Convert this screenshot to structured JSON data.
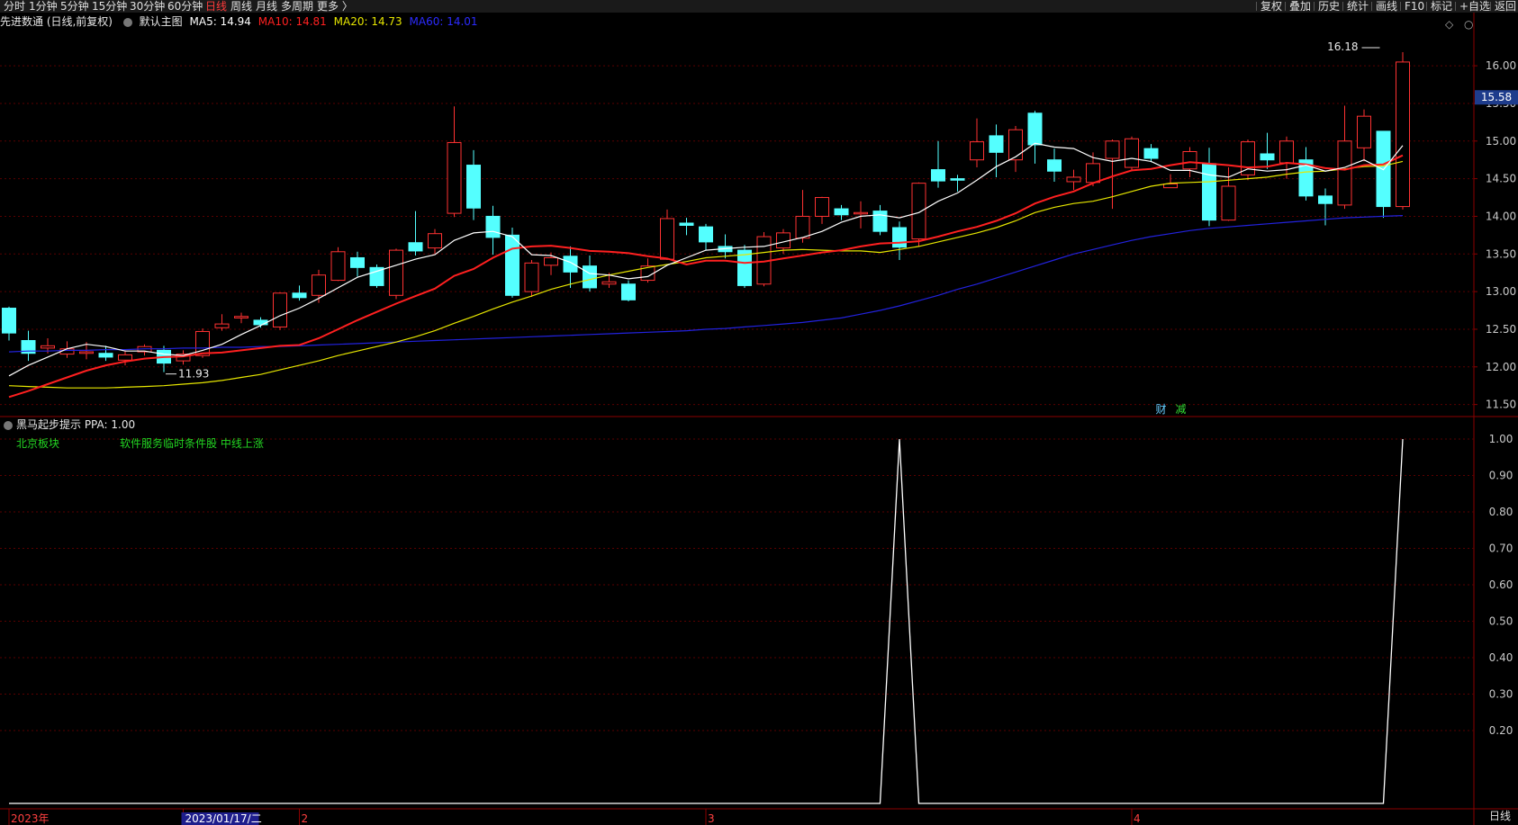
{
  "toolbar": {
    "left": [
      {
        "label": "分时"
      },
      {
        "label": "1分钟"
      },
      {
        "label": "5分钟"
      },
      {
        "label": "15分钟"
      },
      {
        "label": "30分钟"
      },
      {
        "label": "60分钟"
      },
      {
        "label": "日线",
        "active": true
      },
      {
        "label": "周线"
      },
      {
        "label": "月线"
      },
      {
        "label": "多周期"
      },
      {
        "label": "更多 〉"
      }
    ],
    "right": [
      {
        "label": "复权"
      },
      {
        "label": "叠加"
      },
      {
        "label": "历史"
      },
      {
        "label": "统计"
      },
      {
        "label": "画线"
      },
      {
        "label": "F10"
      },
      {
        "label": "标记"
      },
      {
        "label": "+自选"
      },
      {
        "label": "返回"
      }
    ]
  },
  "legend": {
    "stock": "先进数通 (日线,前复权)",
    "main_label": "默认主图",
    "ma5": "MA5: 14.94",
    "ma10": "MA10: 14.81",
    "ma20": "MA20: 14.73",
    "ma60": "MA60: 14.01"
  },
  "indicator": {
    "title": "黑马起步提示 PPA: 1.00",
    "label1": "北京板块",
    "label2": "软件服务临时条件股  中线上涨"
  },
  "badges": {
    "cai": "财",
    "jian": "减"
  },
  "price_tag": "15.58",
  "bottom_right": "日线",
  "colors": {
    "up": "#ff3232",
    "down": "#54ffff",
    "ma5": "#ffffff",
    "ma10": "#ff2020",
    "ma20": "#e6e600",
    "ma60": "#2222dd",
    "grid": "#5a0000",
    "axis": "#8b0000",
    "ppa": "#ffffff"
  },
  "chart_data": [
    {
      "type": "candlestick",
      "title": "先进数通 (日线,前复权)",
      "ylim": [
        11.4,
        16.3
      ],
      "yticks": [
        11.5,
        12.0,
        12.5,
        13.0,
        13.5,
        14.0,
        14.5,
        15.0,
        15.5,
        16.0
      ],
      "ytick_labels": [
        "11.50",
        "12.00",
        "12.50",
        "13.00",
        "13.50",
        "14.00",
        "14.50",
        "15.00",
        "15.50",
        "16.00"
      ],
      "xtick_labels": [
        "2023年",
        "2023/01/17/二",
        "2",
        "3",
        "4"
      ],
      "xtick_index": [
        0,
        9,
        15,
        36,
        58
      ],
      "annotations": [
        {
          "text": "16.18",
          "index": 71,
          "value": 16.18
        },
        {
          "text": "11.93",
          "index": 8,
          "value": 11.93
        }
      ],
      "candles": [
        [
          12.78,
          12.45,
          12.8,
          12.35
        ],
        [
          12.35,
          12.18,
          12.48,
          12.08
        ],
        [
          12.25,
          12.28,
          12.38,
          12.18
        ],
        [
          12.17,
          12.24,
          12.34,
          12.12
        ],
        [
          12.18,
          12.2,
          12.33,
          12.1
        ],
        [
          12.18,
          12.13,
          12.28,
          12.08
        ],
        [
          12.09,
          12.16,
          12.22,
          12.02
        ],
        [
          12.2,
          12.27,
          12.3,
          12.15
        ],
        [
          12.22,
          12.05,
          12.28,
          11.93
        ],
        [
          12.08,
          12.17,
          12.22,
          12.03
        ],
        [
          12.15,
          12.47,
          12.51,
          12.12
        ],
        [
          12.52,
          12.57,
          12.7,
          12.48
        ],
        [
          12.65,
          12.67,
          12.72,
          12.58
        ],
        [
          12.62,
          12.56,
          12.66,
          12.52
        ],
        [
          12.53,
          12.98,
          12.99,
          12.49
        ],
        [
          12.98,
          12.92,
          13.08,
          12.88
        ],
        [
          12.95,
          13.22,
          13.29,
          12.85
        ],
        [
          13.15,
          13.53,
          13.59,
          13.14
        ],
        [
          13.45,
          13.32,
          13.53,
          13.2
        ],
        [
          13.32,
          13.08,
          13.36,
          13.05
        ],
        [
          12.95,
          13.55,
          13.57,
          12.9
        ],
        [
          13.65,
          13.54,
          14.07,
          13.48
        ],
        [
          13.58,
          13.77,
          13.83,
          13.5
        ],
        [
          14.04,
          14.98,
          15.46,
          13.99
        ],
        [
          14.68,
          14.11,
          14.88,
          13.95
        ],
        [
          14.0,
          13.72,
          14.14,
          13.49
        ],
        [
          13.75,
          12.95,
          13.85,
          12.92
        ],
        [
          13.0,
          13.38,
          13.42,
          12.93
        ],
        [
          13.35,
          13.45,
          13.52,
          13.22
        ],
        [
          13.47,
          13.26,
          13.6,
          13.05
        ],
        [
          13.34,
          13.05,
          13.48,
          13.0
        ],
        [
          13.1,
          13.13,
          13.25,
          13.05
        ],
        [
          13.1,
          12.89,
          13.15,
          12.87
        ],
        [
          13.15,
          13.34,
          13.44,
          13.12
        ],
        [
          13.43,
          13.97,
          14.09,
          13.42
        ],
        [
          13.91,
          13.88,
          13.98,
          13.75
        ],
        [
          13.86,
          13.66,
          13.9,
          13.55
        ],
        [
          13.6,
          13.53,
          13.76,
          13.44
        ],
        [
          13.55,
          13.08,
          13.62,
          13.05
        ],
        [
          13.1,
          13.73,
          13.79,
          13.07
        ],
        [
          13.58,
          13.78,
          13.83,
          13.5
        ],
        [
          13.71,
          14.0,
          14.35,
          13.65
        ],
        [
          14.0,
          14.25,
          14.26,
          13.9
        ],
        [
          14.1,
          14.02,
          14.15,
          13.95
        ],
        [
          14.05,
          14.05,
          14.2,
          13.84
        ],
        [
          14.07,
          13.8,
          14.15,
          13.75
        ],
        [
          13.85,
          13.59,
          13.93,
          13.42
        ],
        [
          13.7,
          14.44,
          14.45,
          13.6
        ],
        [
          14.62,
          14.47,
          15.0,
          14.38
        ],
        [
          14.5,
          14.48,
          14.55,
          14.33
        ],
        [
          14.75,
          14.99,
          15.3,
          14.65
        ],
        [
          15.07,
          14.85,
          15.22,
          14.52
        ],
        [
          14.75,
          15.15,
          15.2,
          14.59
        ],
        [
          15.37,
          14.95,
          15.4,
          14.7
        ],
        [
          14.75,
          14.6,
          14.9,
          14.46
        ],
        [
          14.46,
          14.52,
          14.62,
          14.35
        ],
        [
          14.45,
          14.7,
          14.85,
          14.4
        ],
        [
          14.77,
          15.0,
          15.02,
          14.1
        ],
        [
          14.65,
          15.03,
          15.06,
          14.6
        ],
        [
          14.9,
          14.77,
          14.96,
          14.72
        ],
        [
          14.38,
          14.43,
          14.56,
          14.38
        ],
        [
          14.63,
          14.86,
          14.92,
          14.52
        ],
        [
          14.7,
          13.95,
          14.91,
          13.87
        ],
        [
          13.95,
          14.4,
          14.65,
          13.94
        ],
        [
          14.55,
          14.99,
          15.02,
          14.48
        ],
        [
          14.83,
          14.75,
          15.11,
          14.63
        ],
        [
          14.71,
          15.0,
          15.06,
          14.5
        ],
        [
          14.75,
          14.27,
          14.92,
          14.21
        ],
        [
          14.27,
          14.17,
          14.37,
          13.88
        ],
        [
          14.15,
          15.0,
          15.47,
          14.1
        ],
        [
          14.91,
          15.33,
          15.42,
          14.73
        ],
        [
          15.13,
          14.13,
          15.13,
          13.98
        ],
        [
          14.13,
          16.05,
          16.18,
          14.09
        ]
      ],
      "ma5": [
        11.88,
        12.02,
        12.13,
        12.24,
        12.3,
        12.27,
        12.21,
        12.21,
        12.17,
        12.15,
        12.22,
        12.3,
        12.43,
        12.55,
        12.68,
        12.78,
        12.91,
        13.05,
        13.19,
        13.27,
        13.35,
        13.43,
        13.49,
        13.68,
        13.78,
        13.8,
        13.73,
        13.49,
        13.48,
        13.39,
        13.24,
        13.22,
        13.17,
        13.2,
        13.35,
        13.45,
        13.55,
        13.57,
        13.59,
        13.6,
        13.66,
        13.72,
        13.8,
        13.92,
        14.0,
        14.02,
        13.98,
        14.05,
        14.2,
        14.31,
        14.48,
        14.66,
        14.79,
        14.97,
        14.92,
        14.9,
        14.78,
        14.73,
        14.77,
        14.73,
        14.61,
        14.61,
        14.55,
        14.52,
        14.63,
        14.6,
        14.62,
        14.68,
        14.6,
        14.65,
        14.75,
        14.62,
        14.94
      ],
      "ma10": [
        11.6,
        11.68,
        11.77,
        11.86,
        11.95,
        12.02,
        12.07,
        12.11,
        12.13,
        12.14,
        12.18,
        12.19,
        12.22,
        12.25,
        12.28,
        12.29,
        12.38,
        12.5,
        12.62,
        12.73,
        12.84,
        12.94,
        13.04,
        13.21,
        13.3,
        13.45,
        13.57,
        13.6,
        13.61,
        13.58,
        13.54,
        13.53,
        13.51,
        13.47,
        13.44,
        13.36,
        13.41,
        13.41,
        13.38,
        13.4,
        13.44,
        13.48,
        13.52,
        13.55,
        13.6,
        13.64,
        13.65,
        13.67,
        13.73,
        13.8,
        13.86,
        13.94,
        14.04,
        14.17,
        14.26,
        14.33,
        14.44,
        14.53,
        14.61,
        14.63,
        14.68,
        14.72,
        14.7,
        14.68,
        14.65,
        14.66,
        14.71,
        14.69,
        14.64,
        14.62,
        14.68,
        14.69,
        14.81
      ],
      "ma20": [
        11.75,
        11.74,
        11.73,
        11.72,
        11.72,
        11.72,
        11.73,
        11.74,
        11.75,
        11.77,
        11.79,
        11.82,
        11.86,
        11.9,
        11.96,
        12.02,
        12.08,
        12.15,
        12.21,
        12.27,
        12.33,
        12.4,
        12.48,
        12.58,
        12.67,
        12.77,
        12.86,
        12.94,
        13.03,
        13.1,
        13.16,
        13.22,
        13.27,
        13.32,
        13.36,
        13.4,
        13.45,
        13.47,
        13.49,
        13.52,
        13.55,
        13.56,
        13.55,
        13.54,
        13.54,
        13.52,
        13.56,
        13.6,
        13.66,
        13.72,
        13.78,
        13.85,
        13.94,
        14.05,
        14.12,
        14.17,
        14.2,
        14.26,
        14.33,
        14.4,
        14.44,
        14.45,
        14.46,
        14.48,
        14.5,
        14.52,
        14.56,
        14.59,
        14.6,
        14.63,
        14.66,
        14.67,
        14.73
      ],
      "ma60": [
        12.2,
        12.21,
        12.21,
        12.22,
        12.22,
        12.23,
        12.23,
        12.24,
        12.24,
        12.25,
        12.25,
        12.26,
        12.26,
        12.27,
        12.27,
        12.28,
        12.29,
        12.3,
        12.31,
        12.32,
        12.33,
        12.34,
        12.35,
        12.36,
        12.37,
        12.38,
        12.39,
        12.4,
        12.41,
        12.42,
        12.43,
        12.44,
        12.45,
        12.46,
        12.47,
        12.48,
        12.5,
        12.51,
        12.53,
        12.55,
        12.57,
        12.59,
        12.62,
        12.65,
        12.7,
        12.75,
        12.81,
        12.88,
        12.95,
        13.03,
        13.1,
        13.18,
        13.26,
        13.34,
        13.42,
        13.5,
        13.56,
        13.62,
        13.68,
        13.73,
        13.77,
        13.81,
        13.84,
        13.86,
        13.88,
        13.9,
        13.92,
        13.94,
        13.96,
        13.98,
        13.99,
        14.0,
        14.01
      ]
    },
    {
      "type": "line",
      "title": "黑马起步提示 PPA",
      "ylim": [
        0,
        1
      ],
      "yticks": [
        0.2,
        0.3,
        0.4,
        0.5,
        0.6,
        0.7,
        0.8,
        0.9,
        1.0
      ],
      "ytick_labels": [
        "0.20",
        "0.30",
        "0.40",
        "0.50",
        "0.60",
        "0.70",
        "0.80",
        "0.90",
        "1.00"
      ],
      "values": [
        0,
        0,
        0,
        0,
        0,
        0,
        0,
        0,
        0,
        0,
        0,
        0,
        0,
        0,
        0,
        0,
        0,
        0,
        0,
        0,
        0,
        0,
        0,
        0,
        0,
        0,
        0,
        0,
        0,
        0,
        0,
        0,
        0,
        0,
        0,
        0,
        0,
        0,
        0,
        0,
        0,
        0,
        0,
        0,
        0,
        0,
        1,
        0,
        0,
        0,
        0,
        0,
        0,
        0,
        0,
        0,
        0,
        0,
        0,
        0,
        0,
        0,
        0,
        0,
        0,
        0,
        0,
        0,
        0,
        0,
        0,
        0,
        1
      ]
    }
  ]
}
